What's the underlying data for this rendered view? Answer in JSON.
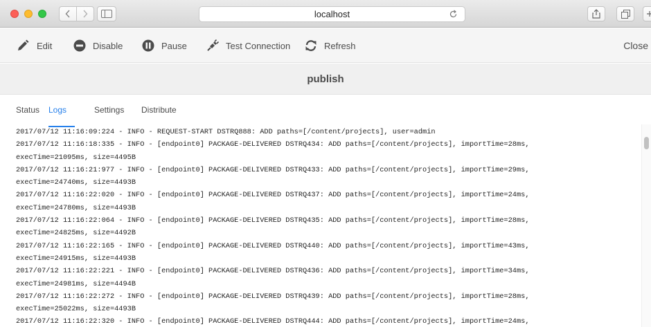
{
  "browser": {
    "address": "localhost"
  },
  "toolbar": {
    "edit_label": "Edit",
    "disable_label": "Disable",
    "pause_label": "Pause",
    "test_connection_label": "Test Connection",
    "refresh_label": "Refresh",
    "close_label": "Close"
  },
  "page": {
    "title": "publish"
  },
  "tabs": [
    {
      "label": "Status",
      "active": false
    },
    {
      "label": "Logs",
      "active": true
    },
    {
      "label": "Settings",
      "active": false
    },
    {
      "label": "Distribute",
      "active": false
    }
  ],
  "log_lines": [
    "2017/07/12 11:16:09:224 - INFO - REQUEST-START DSTRQ888: ADD paths=[/content/projects], user=admin",
    "2017/07/12 11:16:18:335 - INFO - [endpoint0] PACKAGE-DELIVERED DSTRQ434: ADD paths=[/content/projects], importTime=28ms,",
    "execTime=21095ms, size=4495B",
    "2017/07/12 11:16:21:977 - INFO - [endpoint0] PACKAGE-DELIVERED DSTRQ433: ADD paths=[/content/projects], importTime=29ms,",
    "execTime=24740ms, size=4493B",
    "2017/07/12 11:16:22:020 - INFO - [endpoint0] PACKAGE-DELIVERED DSTRQ437: ADD paths=[/content/projects], importTime=24ms,",
    "execTime=24780ms, size=4493B",
    "2017/07/12 11:16:22:064 - INFO - [endpoint0] PACKAGE-DELIVERED DSTRQ435: ADD paths=[/content/projects], importTime=28ms,",
    "execTime=24825ms, size=4492B",
    "2017/07/12 11:16:22:165 - INFO - [endpoint0] PACKAGE-DELIVERED DSTRQ440: ADD paths=[/content/projects], importTime=43ms,",
    "execTime=24915ms, size=4493B",
    "2017/07/12 11:16:22:221 - INFO - [endpoint0] PACKAGE-DELIVERED DSTRQ436: ADD paths=[/content/projects], importTime=34ms,",
    "execTime=24981ms, size=4494B",
    "2017/07/12 11:16:22:272 - INFO - [endpoint0] PACKAGE-DELIVERED DSTRQ439: ADD paths=[/content/projects], importTime=28ms,",
    "execTime=25022ms, size=4493B",
    "2017/07/12 11:16:22:320 - INFO - [endpoint0] PACKAGE-DELIVERED DSTRQ444: ADD paths=[/content/projects], importTime=24ms,"
  ],
  "colors": {
    "accent": "#2680eb",
    "traffic_close": "#fc5f57",
    "traffic_minimize": "#fdbc2e",
    "traffic_zoom": "#33c748"
  },
  "icons": {
    "edit": "pencil-icon",
    "disable": "minus-circle-icon",
    "pause": "pause-circle-icon",
    "test_connection": "plug-icon",
    "refresh": "refresh-icon"
  }
}
